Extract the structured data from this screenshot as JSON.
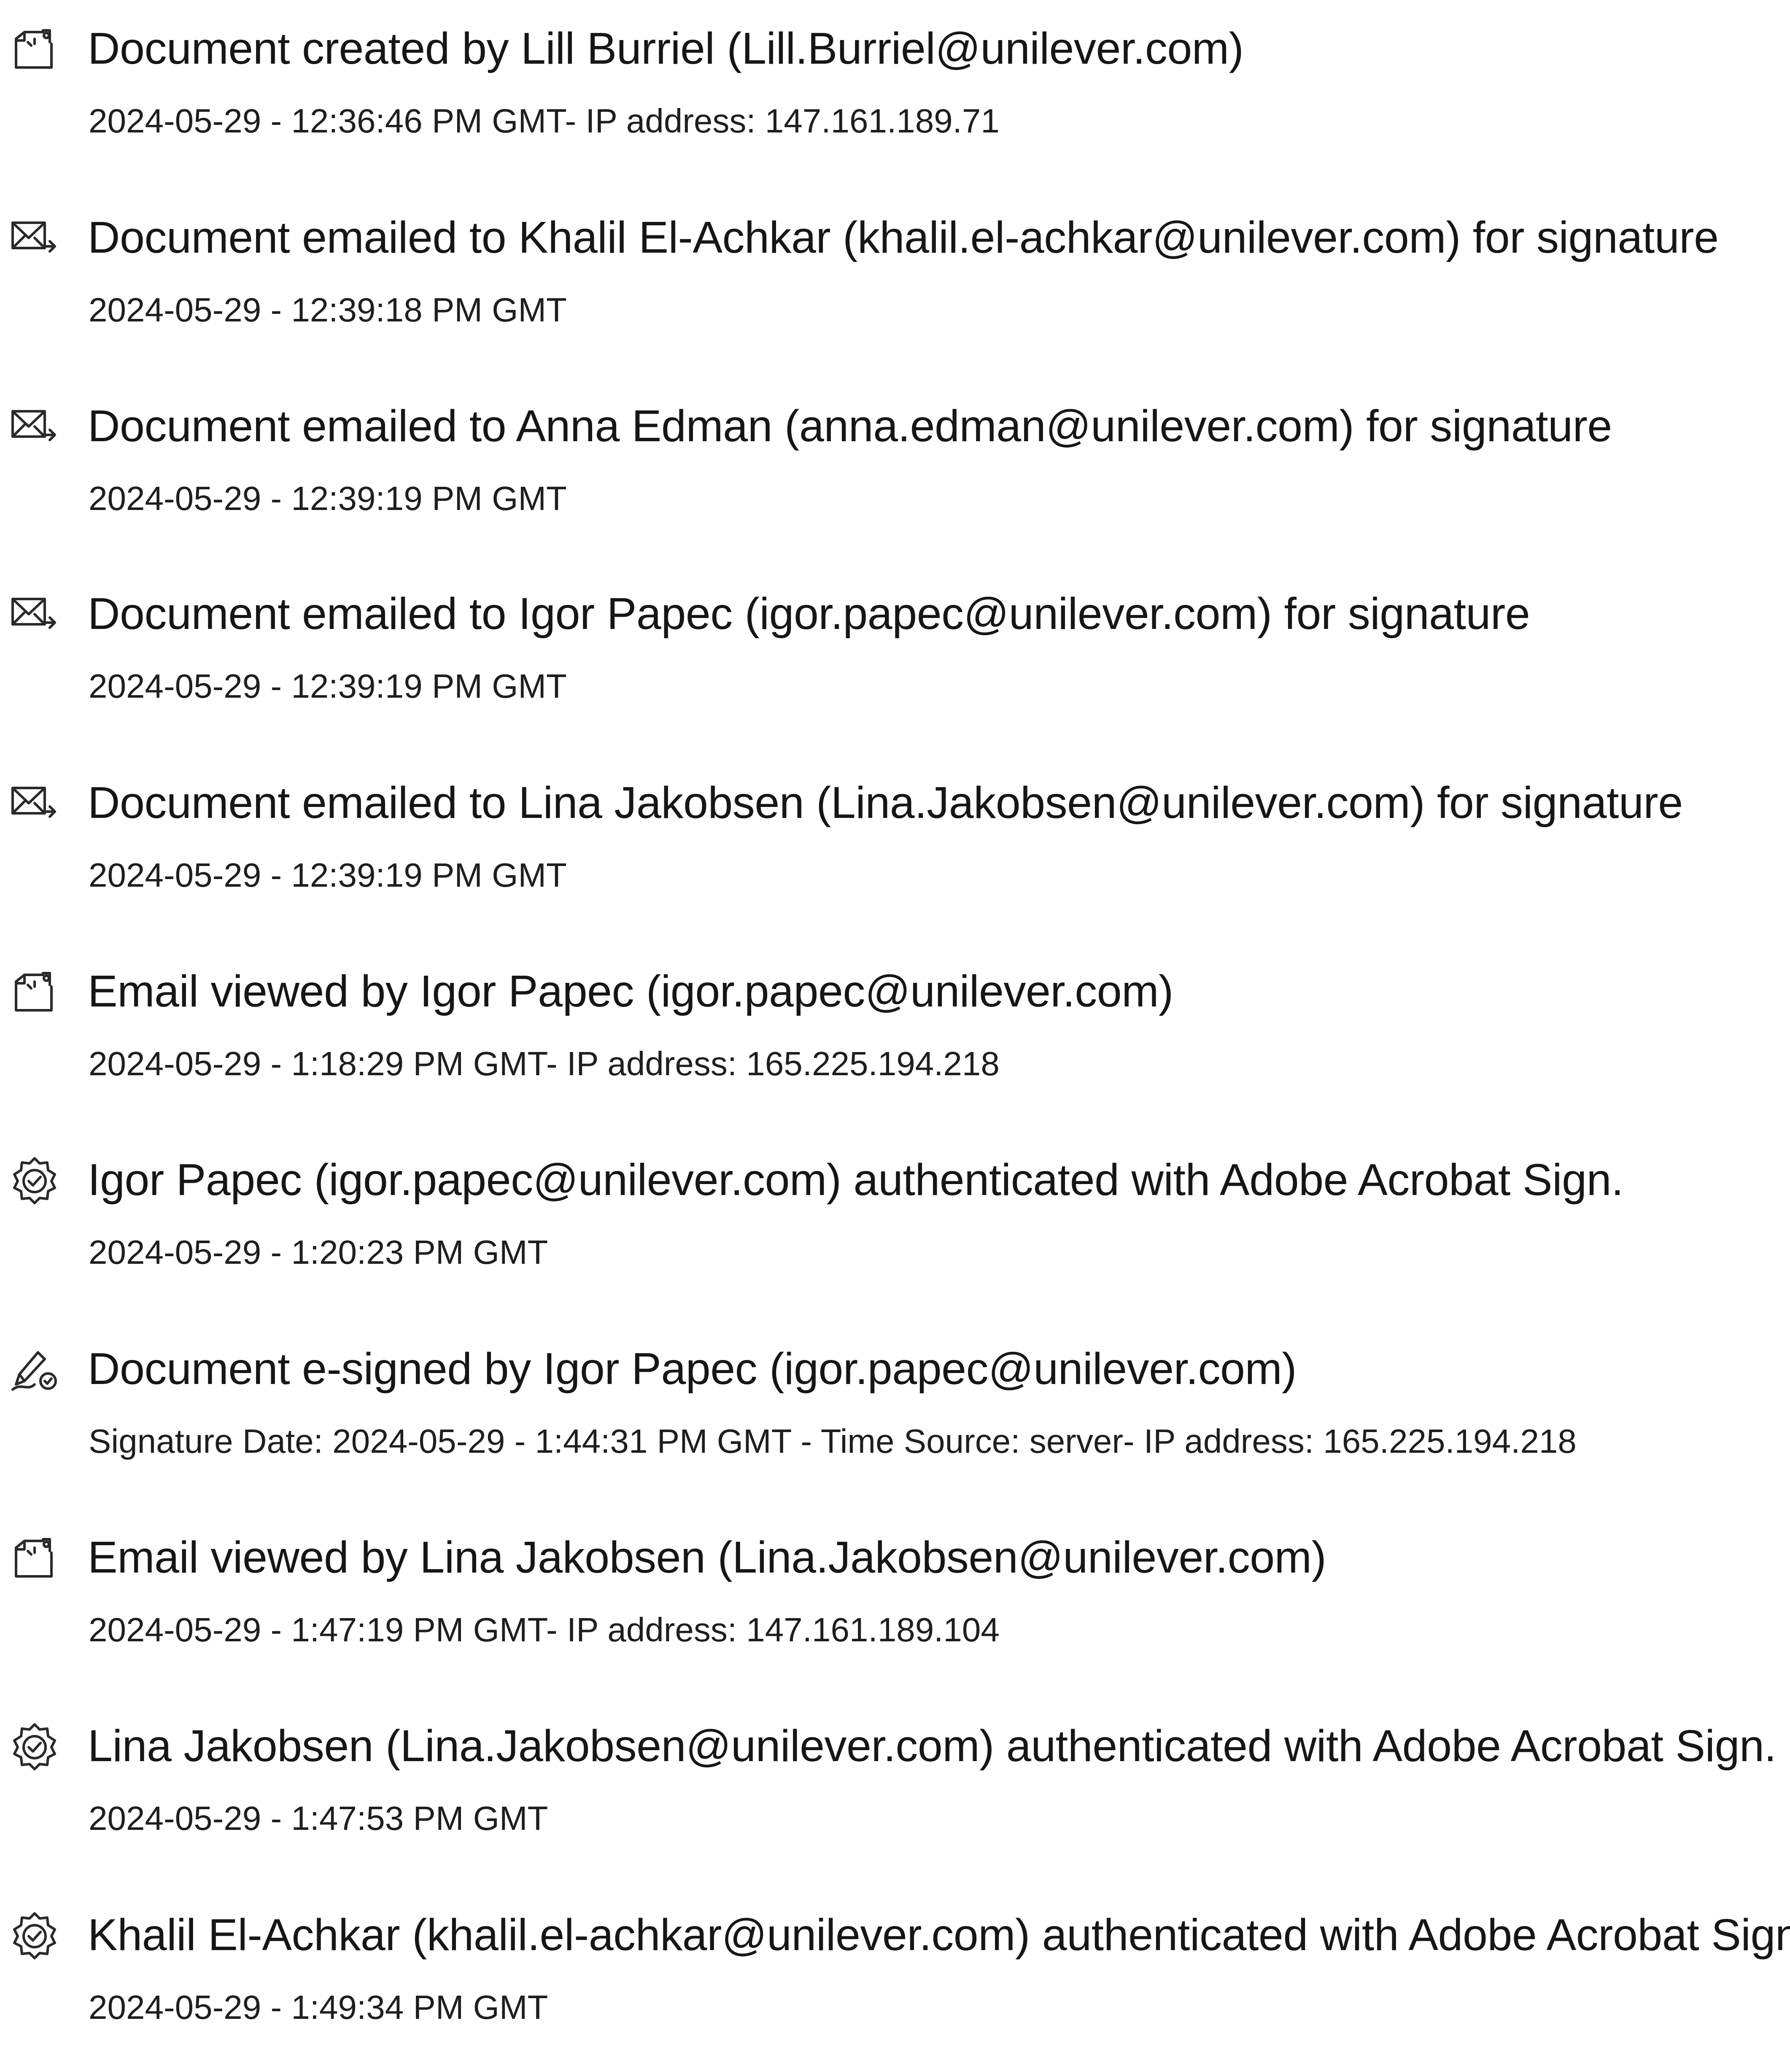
{
  "events": [
    {
      "icon": "document-created-icon",
      "title": "Document created by Lill Burriel (Lill.Burriel@unilever.com)",
      "detail": "2024-05-29 - 12:36:46 PM GMT- IP address: 147.161.189.71"
    },
    {
      "icon": "email-sent-icon",
      "title": "Document emailed to Khalil El-Achkar (khalil.el-achkar@unilever.com) for signature",
      "detail": "2024-05-29 - 12:39:18 PM GMT"
    },
    {
      "icon": "email-sent-icon",
      "title": "Document emailed to Anna Edman (anna.edman@unilever.com) for signature",
      "detail": "2024-05-29 - 12:39:19 PM GMT"
    },
    {
      "icon": "email-sent-icon",
      "title": "Document emailed to Igor Papec (igor.papec@unilever.com) for signature",
      "detail": "2024-05-29 - 12:39:19 PM GMT"
    },
    {
      "icon": "email-sent-icon",
      "title": "Document emailed to Lina Jakobsen (Lina.Jakobsen@unilever.com) for signature",
      "detail": "2024-05-29 - 12:39:19 PM GMT"
    },
    {
      "icon": "email-viewed-icon",
      "title": "Email viewed by Igor Papec (igor.papec@unilever.com)",
      "detail": "2024-05-29 - 1:18:29 PM GMT- IP address: 165.225.194.218"
    },
    {
      "icon": "authenticated-icon",
      "title": "Igor Papec (igor.papec@unilever.com) authenticated with Adobe Acrobat Sign.",
      "detail": "2024-05-29 - 1:20:23 PM GMT"
    },
    {
      "icon": "e-signed-icon",
      "title": "Document e-signed by Igor Papec (igor.papec@unilever.com)",
      "detail": "Signature Date: 2024-05-29 - 1:44:31 PM GMT - Time Source: server- IP address: 165.225.194.218"
    },
    {
      "icon": "email-viewed-icon",
      "title": "Email viewed by Lina Jakobsen (Lina.Jakobsen@unilever.com)",
      "detail": "2024-05-29 - 1:47:19 PM GMT- IP address: 147.161.189.104"
    },
    {
      "icon": "authenticated-icon",
      "title": "Lina Jakobsen (Lina.Jakobsen@unilever.com) authenticated with Adobe Acrobat Sign.",
      "detail": "2024-05-29 - 1:47:53 PM GMT"
    },
    {
      "icon": "authenticated-icon",
      "title": "Khalil El-Achkar (khalil.el-achkar@unilever.com) authenticated with Adobe Acrobat Sign.",
      "detail": "2024-05-29 - 1:49:34 PM GMT"
    }
  ]
}
